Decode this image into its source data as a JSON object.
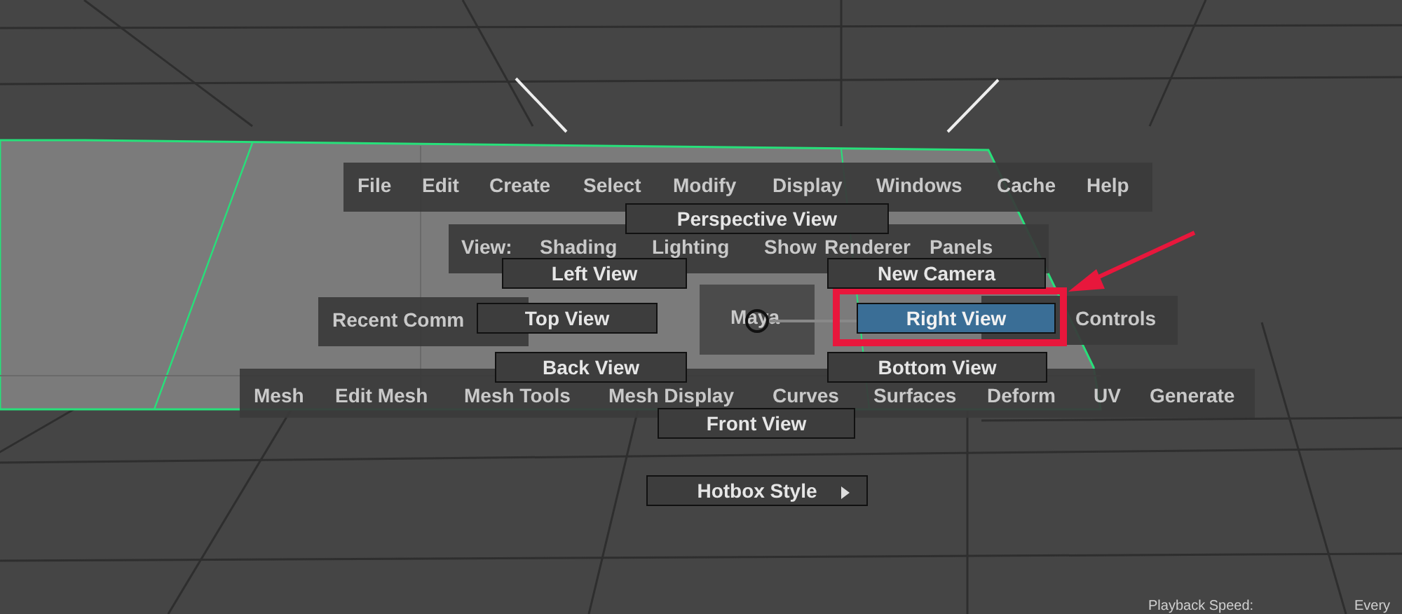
{
  "main_menu": [
    "File",
    "Edit",
    "Create",
    "Select",
    "Modify",
    "Display",
    "Windows",
    "Cache",
    "Help"
  ],
  "panel_menu": [
    "View:",
    "Shading",
    "Lighting",
    "Show",
    "Renderer",
    "Panels"
  ],
  "west_menu": "Recent Comm",
  "center_label": "Maya",
  "east_menu": "Controls",
  "module_menu": [
    "Mesh",
    "Edit Mesh",
    "Mesh Tools",
    "Mesh Display",
    "Curves",
    "Surfaces",
    "Deform",
    "UV",
    "Generate"
  ],
  "marking_menu": [
    {
      "label": "Perspective View",
      "selected": false,
      "submenu": false
    },
    {
      "label": "Left View",
      "selected": false,
      "submenu": false
    },
    {
      "label": "New Camera",
      "selected": false,
      "submenu": false
    },
    {
      "label": "Top View",
      "selected": false,
      "submenu": false
    },
    {
      "label": "Right View",
      "selected": true,
      "submenu": false
    },
    {
      "label": "Back View",
      "selected": false,
      "submenu": false
    },
    {
      "label": "Bottom View",
      "selected": false,
      "submenu": false
    },
    {
      "label": "Front View",
      "selected": false,
      "submenu": false
    },
    {
      "label": "Hotbox Style",
      "selected": false,
      "submenu": true
    }
  ],
  "time_slider": {
    "speed_label": "Playback Speed:",
    "speed_value": "Every"
  }
}
